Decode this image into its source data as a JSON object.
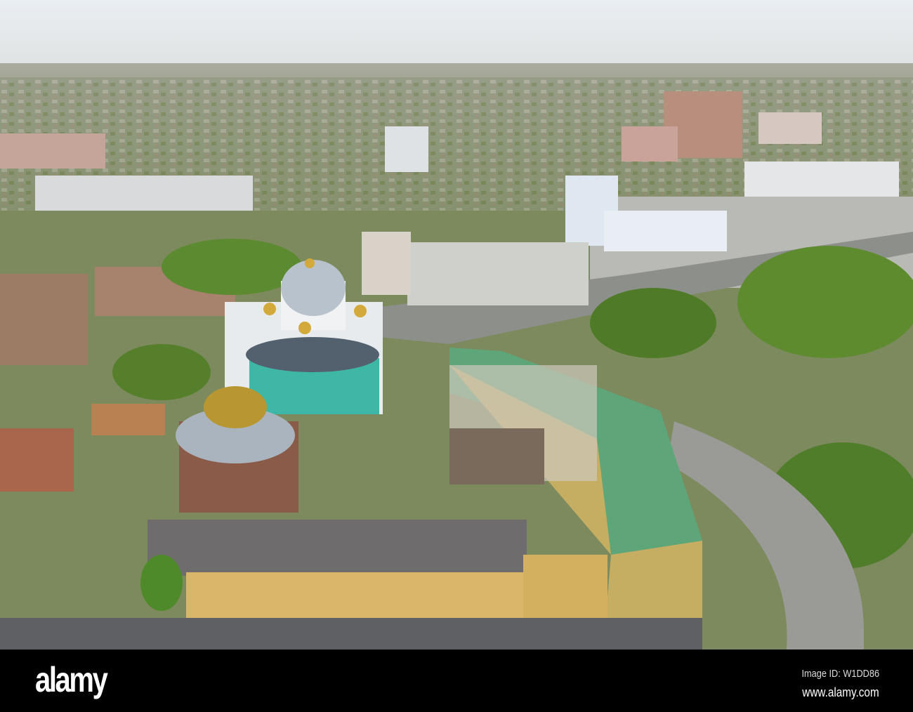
{
  "photo": {
    "alt": "Aerial view of city with cathedral"
  },
  "footer": {
    "logo": "alamy",
    "image_id": "Image ID: W1DD86",
    "url": "www.alamy.com"
  }
}
